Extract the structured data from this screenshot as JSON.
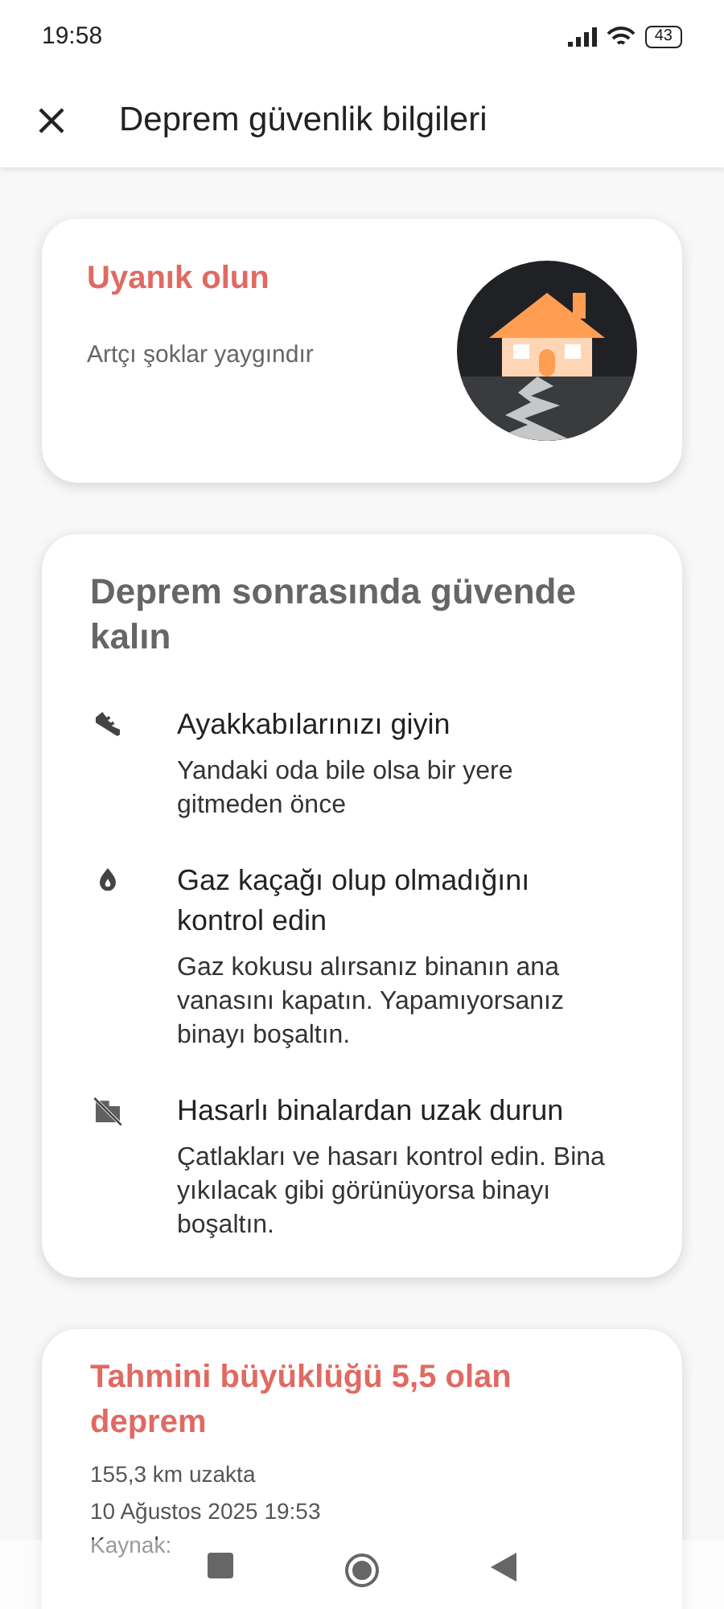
{
  "status_bar": {
    "time": "19:58",
    "battery": "43"
  },
  "app_bar": {
    "title": "Deprem güvenlik bilgileri"
  },
  "alert_card": {
    "title": "Uyanık olun",
    "subtitle": "Artçı şoklar yaygındır"
  },
  "safety_card": {
    "title": "Deprem sonrasında güvende kalın",
    "tips": [
      {
        "kind": "shoe",
        "title": "Ayakkabılarınızı giyin",
        "text": "Yandaki oda bile olsa bir yere gitmeden önce"
      },
      {
        "kind": "gas",
        "title": "Gaz kaçağı olup olmadığını kontrol edin",
        "text": "Gaz kokusu alırsanız binanın ana vanasını kapatın. Yapamıyorsanız binayı boşaltın."
      },
      {
        "kind": "building",
        "title": "Hasarlı binalardan uzak durun",
        "text": "Çatlakları ve hasarı kontrol edin. Bina yıkılacak gibi görünüyorsa binayı boşaltın."
      }
    ]
  },
  "quake_card": {
    "title": "Tahmini büyüklüğü 5,5 olan deprem",
    "distance": "155,3 km uzakta",
    "date": "10 Ağustos 2025 19:53",
    "source": "Kaynak:"
  }
}
